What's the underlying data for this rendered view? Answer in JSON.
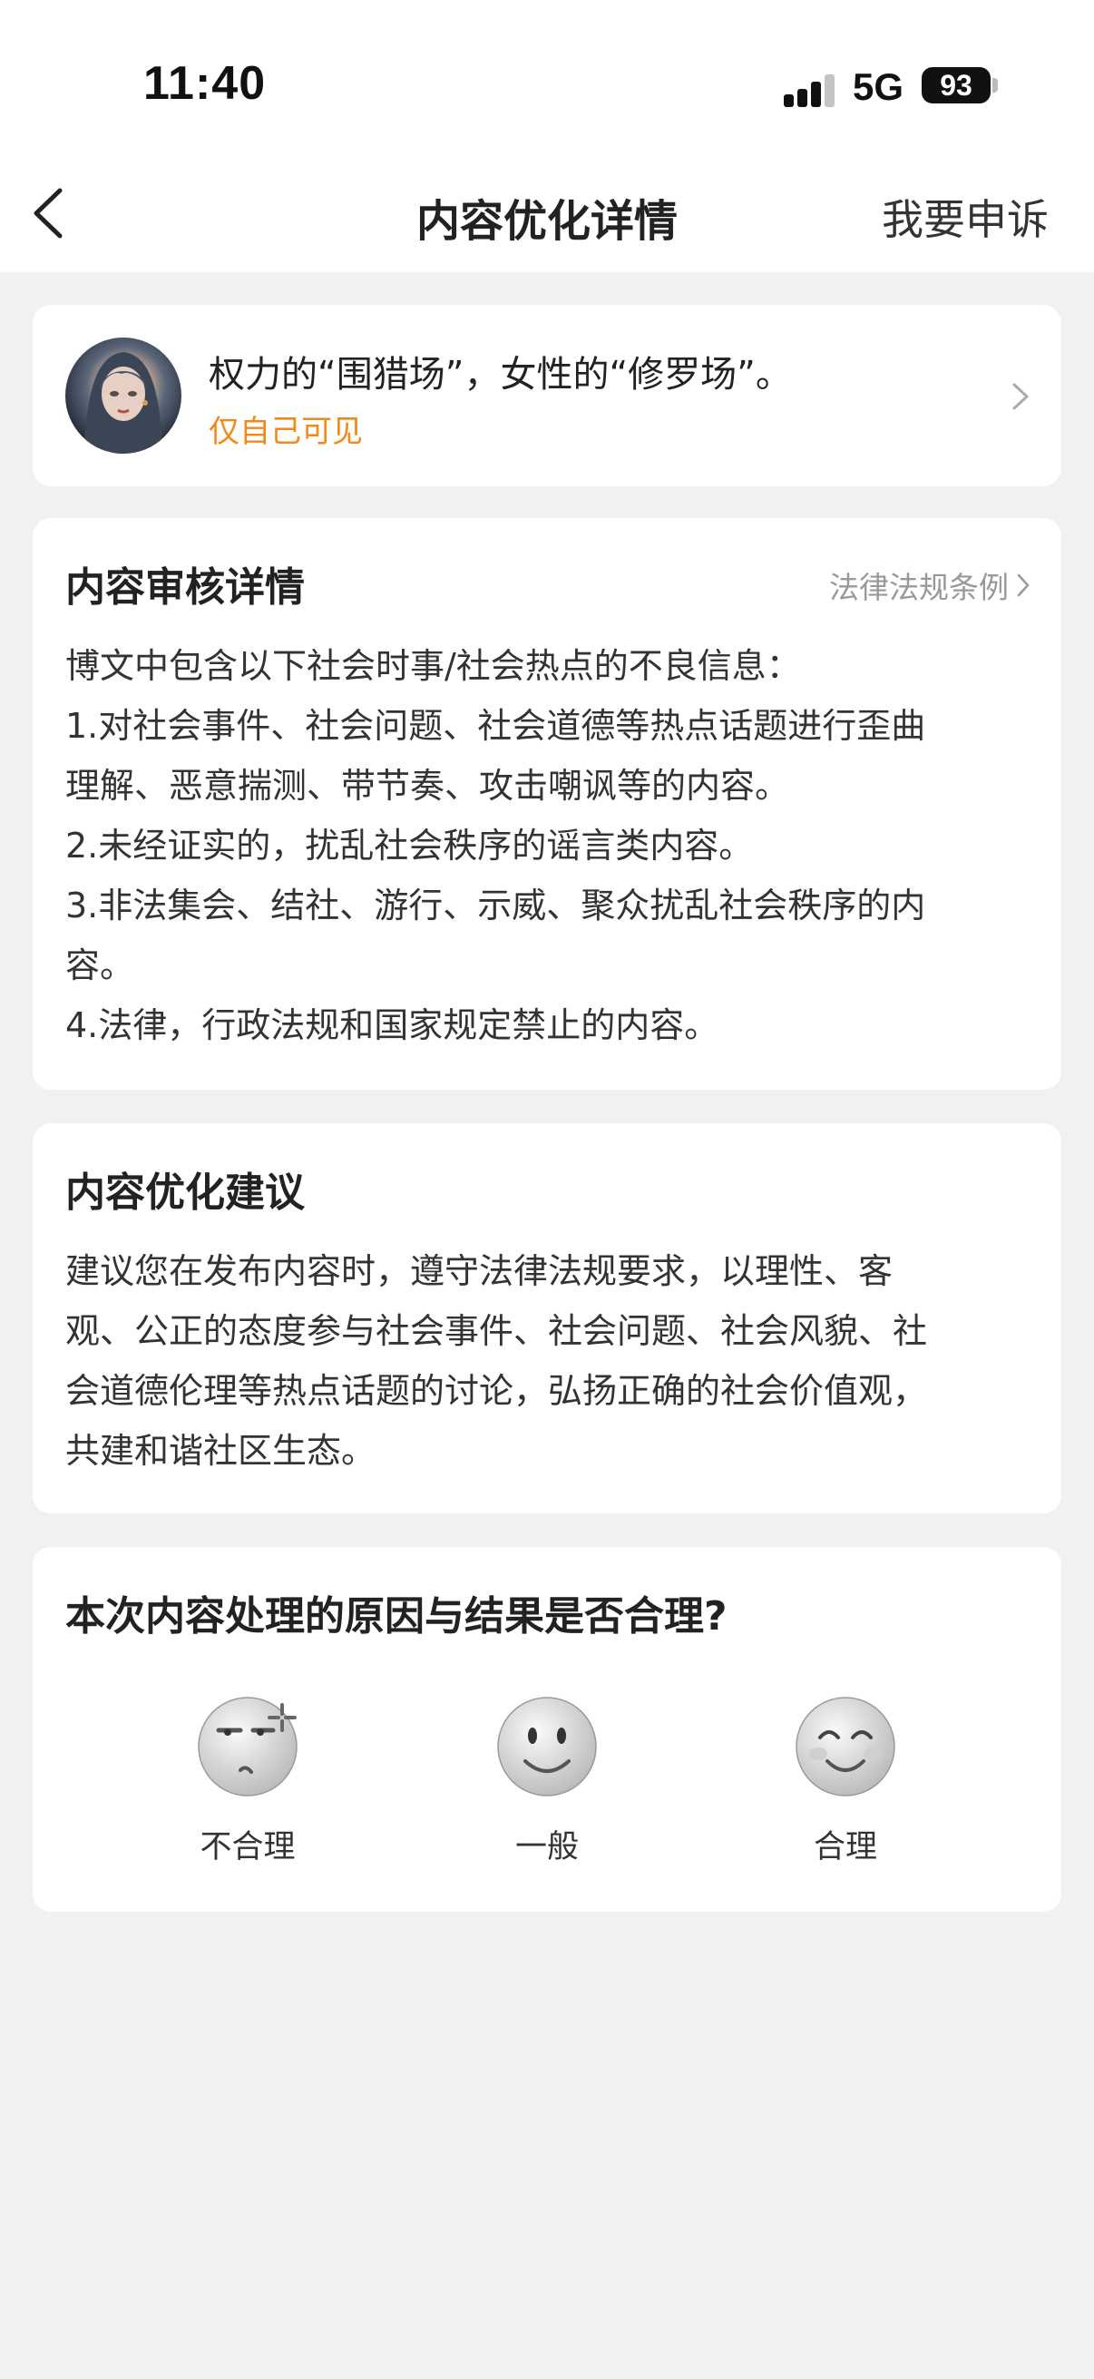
{
  "status_bar": {
    "time": "11:40",
    "network": "5G",
    "battery": "93"
  },
  "nav": {
    "back_icon": "chevron-left-icon",
    "title": "内容优化详情",
    "appeal": "我要申诉"
  },
  "post": {
    "text": "权力的“围猎场”，女性的“修罗场”。",
    "visibility": "仅自己可见",
    "visibility_color": "#f08a1c"
  },
  "review": {
    "title": "内容审核详情",
    "link": "法律法规条例",
    "lines": [
      "博文中包含以下社会时事/社会热点的不良信息：",
      "1.对社会事件、社会问题、社会道德等热点话题进行歪曲",
      "理解、恶意揣测、带节奏、攻击嘲讽等的内容。",
      "2.未经证实的，扰乱社会秩序的谣言类内容。",
      "3.非法集会、结社、游行、示威、聚众扰乱社会秩序的内",
      "容。",
      "4.法律，行政法规和国家规定禁止的内容。"
    ]
  },
  "advice": {
    "title": "内容优化建议",
    "lines": [
      "建议您在发布内容时，遵守法律法规要求，以理性、客",
      "观、公正的态度参与社会事件、社会问题、社会风貌、社",
      "会道德伦理等热点话题的讨论，弘扬正确的社会价值观，",
      "共建和谐社区生态。"
    ]
  },
  "rating": {
    "question": "本次内容处理的原因与结果是否合理?",
    "options": [
      {
        "label": "不合理",
        "icon": "annoyed-face-icon"
      },
      {
        "label": "一般",
        "icon": "neutral-face-icon"
      },
      {
        "label": "合理",
        "icon": "smiling-face-icon"
      }
    ]
  }
}
